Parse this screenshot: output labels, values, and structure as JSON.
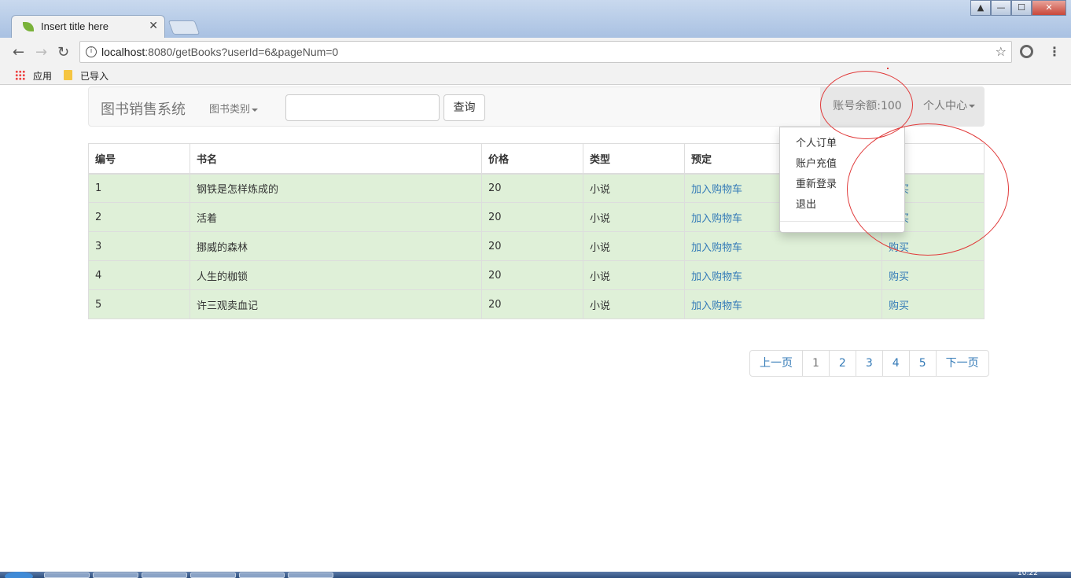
{
  "browser": {
    "tab_title": "Insert title here",
    "tab_close": "✕",
    "url_host": "localhost",
    "url_rest": ":8080/getBooks?userId=6&pageNum=0",
    "bookmarks": [
      {
        "icon": "apps-icon",
        "label": "应用"
      },
      {
        "icon": "folder-icon",
        "label": "已导入"
      }
    ],
    "window_controls": [
      "▲",
      "—",
      "☐",
      "✕"
    ],
    "clock": "10:22"
  },
  "navbar": {
    "brand": "图书销售系统",
    "category_label": "图书类别",
    "search_value": "",
    "search_button": "查询",
    "balance": "账号余额:100",
    "user_center": "个人中心"
  },
  "dropdown": {
    "items": [
      "个人订单",
      "账户充值",
      "重新登录",
      "退出"
    ]
  },
  "table": {
    "headers": [
      "编号",
      "书名",
      "价格",
      "类型",
      "预定",
      ""
    ],
    "rows": [
      {
        "id": "1",
        "name": "钢铁是怎样炼成的",
        "price": "20",
        "type": "小说",
        "reserve": "加入购物车",
        "buy": "购买"
      },
      {
        "id": "2",
        "name": "活着",
        "price": "20",
        "type": "小说",
        "reserve": "加入购物车",
        "buy": "购买"
      },
      {
        "id": "3",
        "name": "挪威的森林",
        "price": "20",
        "type": "小说",
        "reserve": "加入购物车",
        "buy": "购买"
      },
      {
        "id": "4",
        "name": "人生的枷锁",
        "price": "20",
        "type": "小说",
        "reserve": "加入购物车",
        "buy": "购买"
      },
      {
        "id": "5",
        "name": "许三观卖血记",
        "price": "20",
        "type": "小说",
        "reserve": "加入购物车",
        "buy": "购买"
      }
    ]
  },
  "pagination": {
    "prev": "上一页",
    "pages": [
      "1",
      "2",
      "3",
      "4",
      "5"
    ],
    "current": "1",
    "next": "下一页"
  },
  "colors": {
    "row_success": "#dff0d8",
    "link": "#337ab7",
    "annotation": "#e03a3a"
  }
}
